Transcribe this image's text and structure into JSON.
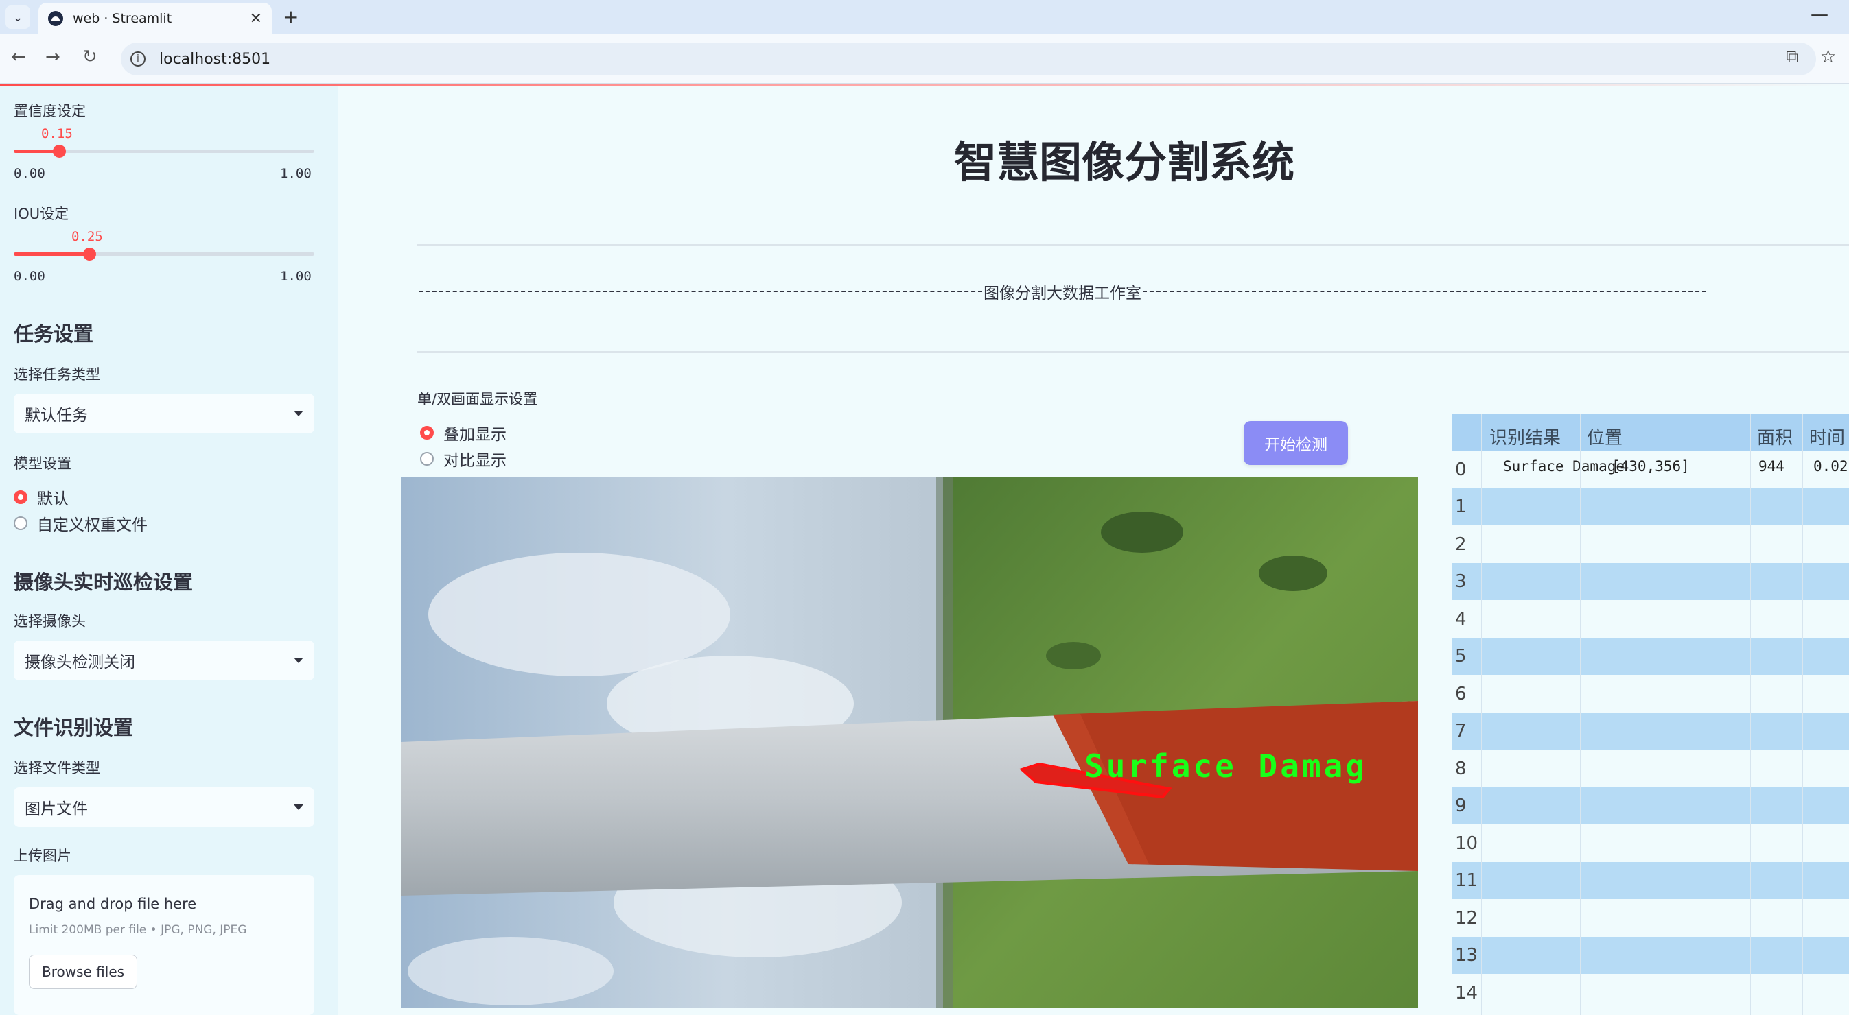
{
  "browser": {
    "tab_title": "web · Streamlit",
    "url": "localhost:8501"
  },
  "sidebar": {
    "confidence": {
      "label": "置信度设定",
      "value": "0.15",
      "min": "0.00",
      "max": "1.00",
      "fraction": 0.15
    },
    "iou": {
      "label": "IOU设定",
      "value": "0.25",
      "min": "0.00",
      "max": "1.00",
      "fraction": 0.25
    },
    "task_section": "任务设置",
    "task_type_label": "选择任务类型",
    "task_type_value": "默认任务",
    "model_label": "模型设置",
    "model_options": [
      "默认",
      "自定义权重文件"
    ],
    "camera_section": "摄像头实时巡检设置",
    "camera_label": "选择摄像头",
    "camera_value": "摄像头检测关闭",
    "file_section": "文件识别设置",
    "file_type_label": "选择文件类型",
    "file_type_value": "图片文件",
    "upload_label": "上传图片",
    "dropzone_title": "Drag and drop file here",
    "dropzone_limit": "Limit 200MB per file • JPG, PNG, JPEG",
    "browse_button": "Browse files"
  },
  "main": {
    "title": "智慧图像分割系统",
    "studio": "图像分割大数据工作室",
    "display_label": "单/双画面显示设置",
    "display_options": [
      "叠加显示",
      "对比显示"
    ],
    "start_button": "开始检测",
    "detection_label": "Surface  Damag"
  },
  "table": {
    "columns": [
      "识别结果",
      "位置",
      "面积",
      "时间"
    ],
    "row0": {
      "index": "0",
      "result": "Surface Damage",
      "position": "[430,356]",
      "area": "944",
      "time": "0.02"
    },
    "indices": [
      "1",
      "2",
      "3",
      "4",
      "5",
      "6",
      "7",
      "8",
      "9",
      "10",
      "11",
      "12",
      "13",
      "14"
    ]
  },
  "colors": {
    "accent": "#ff4b4b",
    "button": "#8b8cf5",
    "sidebar": "#e5f6fb",
    "table_header": "#a9d2f3"
  },
  "icons": [
    "tab-menu-icon",
    "streamlit-icon",
    "close-icon",
    "plus-icon",
    "back-icon",
    "forward-icon",
    "reload-icon",
    "info-icon",
    "translate-icon",
    "star-icon",
    "minimize-icon"
  ]
}
